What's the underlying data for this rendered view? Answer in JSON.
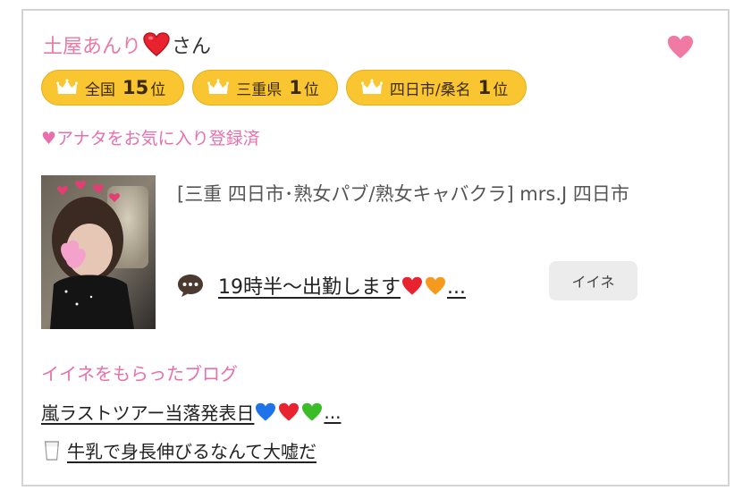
{
  "profile": {
    "name": "土屋あんり",
    "suffix": "さん",
    "favorite_icon": "heart-icon"
  },
  "rankings": [
    {
      "label": "全国",
      "rank": "15",
      "suffix": "位"
    },
    {
      "label": "三重県",
      "rank": "1",
      "suffix": "位"
    },
    {
      "label": "四日市/桑名",
      "rank": "1",
      "suffix": "位"
    }
  ],
  "favorite_status": "♥アナタをお気に入り登録済",
  "shop": {
    "text": "[三重 四日市･熟女パブ/熟女キャバクラ]  mrs.J 四日市"
  },
  "comment": {
    "text": "19時半～出勤します",
    "ellipsis": "...",
    "like_button": "イイネ"
  },
  "blogs": {
    "heading": "イイネをもらったブログ",
    "items": [
      {
        "text": "嵐ラストツアー当落発表日",
        "ellipsis": "..."
      },
      {
        "text": "牛乳で身長伸びるなんて大嘘だ"
      }
    ]
  },
  "colors": {
    "accent_pink": "#e96faa",
    "badge_yellow": "#f9c531",
    "heart_red": "#e8232f"
  }
}
